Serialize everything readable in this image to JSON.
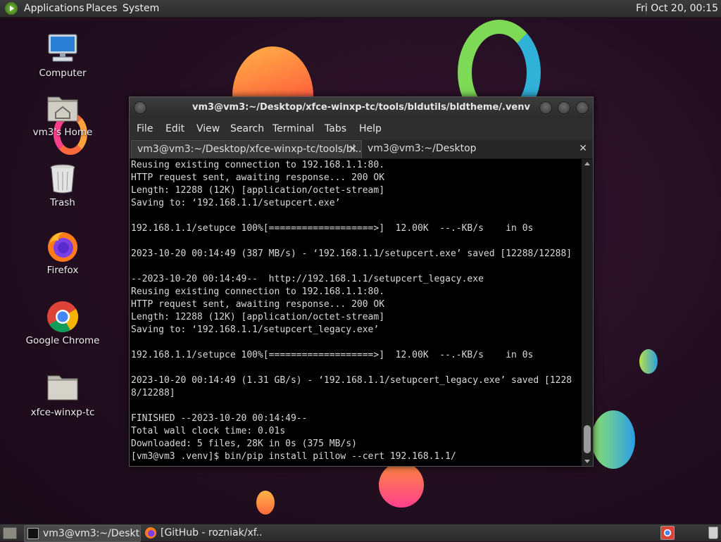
{
  "top_panel": {
    "menu": [
      "Applications",
      "Places",
      "System"
    ],
    "clock": "Fri Oct 20, 00:15"
  },
  "desktop": {
    "icons": [
      {
        "label": "Computer",
        "icon": "computer-icon"
      },
      {
        "label": "vm3's Home",
        "icon": "home-folder-icon"
      },
      {
        "label": "Trash",
        "icon": "trash-icon"
      },
      {
        "label": "Firefox",
        "icon": "firefox-icon"
      },
      {
        "label": "Google Chrome",
        "icon": "chrome-icon"
      },
      {
        "label": "xfce-winxp-tc",
        "icon": "folder-icon"
      }
    ]
  },
  "terminal": {
    "title": "vm3@vm3:~/Desktop/xfce-winxp-tc/tools/bldutils/bldtheme/.venv",
    "menu": [
      "File",
      "Edit",
      "View",
      "Search",
      "Terminal",
      "Tabs",
      "Help"
    ],
    "tabs": [
      {
        "label": "vm3@vm3:~/Desktop/xfce-winxp-tc/tools/bl...",
        "active": true
      },
      {
        "label": "vm3@vm3:~/Desktop",
        "active": false
      }
    ],
    "lines": [
      "Reusing existing connection to 192.168.1.1:80.",
      "HTTP request sent, awaiting response... 200 OK",
      "Length: 12288 (12K) [application/octet-stream]",
      "Saving to: ‘192.168.1.1/setupcert.exe’",
      "",
      "192.168.1.1/setupce 100%[===================>]  12.00K  --.-KB/s    in 0s",
      "",
      "2023-10-20 00:14:49 (387 MB/s) - ‘192.168.1.1/setupcert.exe’ saved [12288/12288]",
      "",
      "--2023-10-20 00:14:49--  http://192.168.1.1/setupcert_legacy.exe",
      "Reusing existing connection to 192.168.1.1:80.",
      "HTTP request sent, awaiting response... 200 OK",
      "Length: 12288 (12K) [application/octet-stream]",
      "Saving to: ‘192.168.1.1/setupcert_legacy.exe’",
      "",
      "192.168.1.1/setupce 100%[===================>]  12.00K  --.-KB/s    in 0s",
      "",
      "2023-10-20 00:14:49 (1.31 GB/s) - ‘192.168.1.1/setupcert_legacy.exe’ saved [1228",
      "8/12288]",
      "",
      "FINISHED --2023-10-20 00:14:49--",
      "Total wall clock time: 0.01s",
      "Downloaded: 5 files, 28K in 0s (375 MB/s)",
      "[vm3@vm3 .venv]$ bin/pip install pillow --cert 192.168.1.1/"
    ]
  },
  "taskbar": {
    "tasks": [
      {
        "label": "vm3@vm3:~/Deskt...",
        "icon": "terminal-icon",
        "active": true
      },
      {
        "label": "[GitHub - rozniak/xf...",
        "icon": "firefox-icon",
        "active": false
      }
    ]
  },
  "colors": {
    "background": "#240f21",
    "panel": "#333333",
    "terminal_bg": "#000000",
    "terminal_fg": "#d9d9d9"
  }
}
